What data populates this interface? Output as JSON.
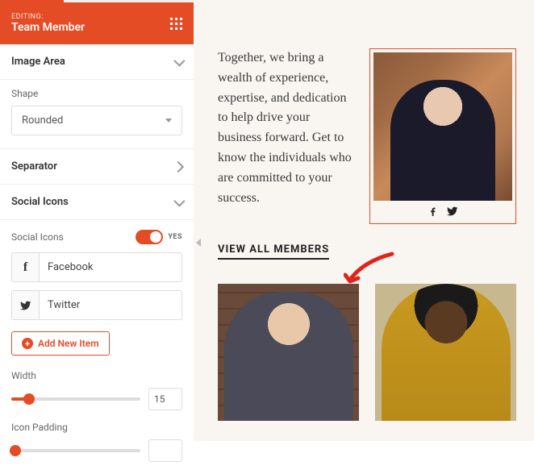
{
  "header": {
    "editing_label": "EDITING:",
    "module_title": "Team Member"
  },
  "sections": {
    "image_area": {
      "label": "Image Area",
      "shape_label": "Shape",
      "shape_value": "Rounded"
    },
    "separator": {
      "label": "Separator"
    },
    "social_icons": {
      "label": "Social Icons",
      "toggle_label": "Social Icons",
      "toggle_state": "YES",
      "items": [
        {
          "icon": "facebook",
          "name": "Facebook"
        },
        {
          "icon": "twitter",
          "name": "Twitter"
        }
      ],
      "add_label": "Add New Item",
      "width_label": "Width",
      "width_value": "15",
      "icon_padding_label": "Icon Padding",
      "icon_padding_value": ""
    }
  },
  "preview": {
    "intro": "Together, we bring a wealth of experience, expertise, and dedication to help drive your business forward. Get to know the individuals who are committed to your success.",
    "view_all_label": "VIEW ALL MEMBERS"
  },
  "icons": {
    "facebook_glyph": "f",
    "plus_glyph": "+"
  },
  "colors": {
    "accent": "#e44c26"
  }
}
